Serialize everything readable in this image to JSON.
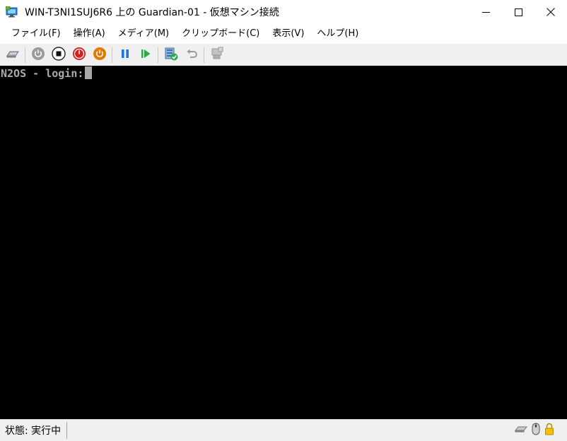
{
  "window": {
    "title": "WIN-T3NI1SUJ6R6 上の Guardian-01 - 仮想マシン接続",
    "icon": "vm-connection-icon",
    "controls": [
      "minimize-icon",
      "maximize-icon",
      "close-icon"
    ]
  },
  "menu": {
    "items": [
      {
        "label": "ファイル(F)"
      },
      {
        "label": "操作(A)"
      },
      {
        "label": "メディア(M)"
      },
      {
        "label": "クリップボード(C)"
      },
      {
        "label": "表示(V)"
      },
      {
        "label": "ヘルプ(H)"
      }
    ]
  },
  "toolbar": {
    "buttons": [
      {
        "icon": "ctrl-alt-del-icon",
        "enabled": true
      },
      {
        "icon": "start-icon",
        "enabled": false,
        "color": "#8c8c8c"
      },
      {
        "icon": "turn-off-icon",
        "enabled": true,
        "color": "#000000"
      },
      {
        "icon": "shutdown-icon",
        "enabled": true,
        "color": "#d62020"
      },
      {
        "icon": "save-icon",
        "enabled": true,
        "color": "#e07a00"
      },
      {
        "icon": "pause-icon",
        "enabled": true,
        "color": "#1e78d2"
      },
      {
        "icon": "resume-icon",
        "enabled": true,
        "color": "#2da84a"
      },
      {
        "icon": "checkpoint-icon",
        "enabled": true
      },
      {
        "icon": "revert-icon",
        "enabled": false
      },
      {
        "icon": "enhanced-session-icon",
        "enabled": false
      }
    ]
  },
  "console": {
    "prompt": "N2OS - login:",
    "background": "#000000",
    "text_color": "#aaaaaa"
  },
  "status": {
    "label": "状態: 実行中",
    "icons": [
      "keyboard-icon",
      "mouse-icon",
      "lock-icon"
    ]
  }
}
